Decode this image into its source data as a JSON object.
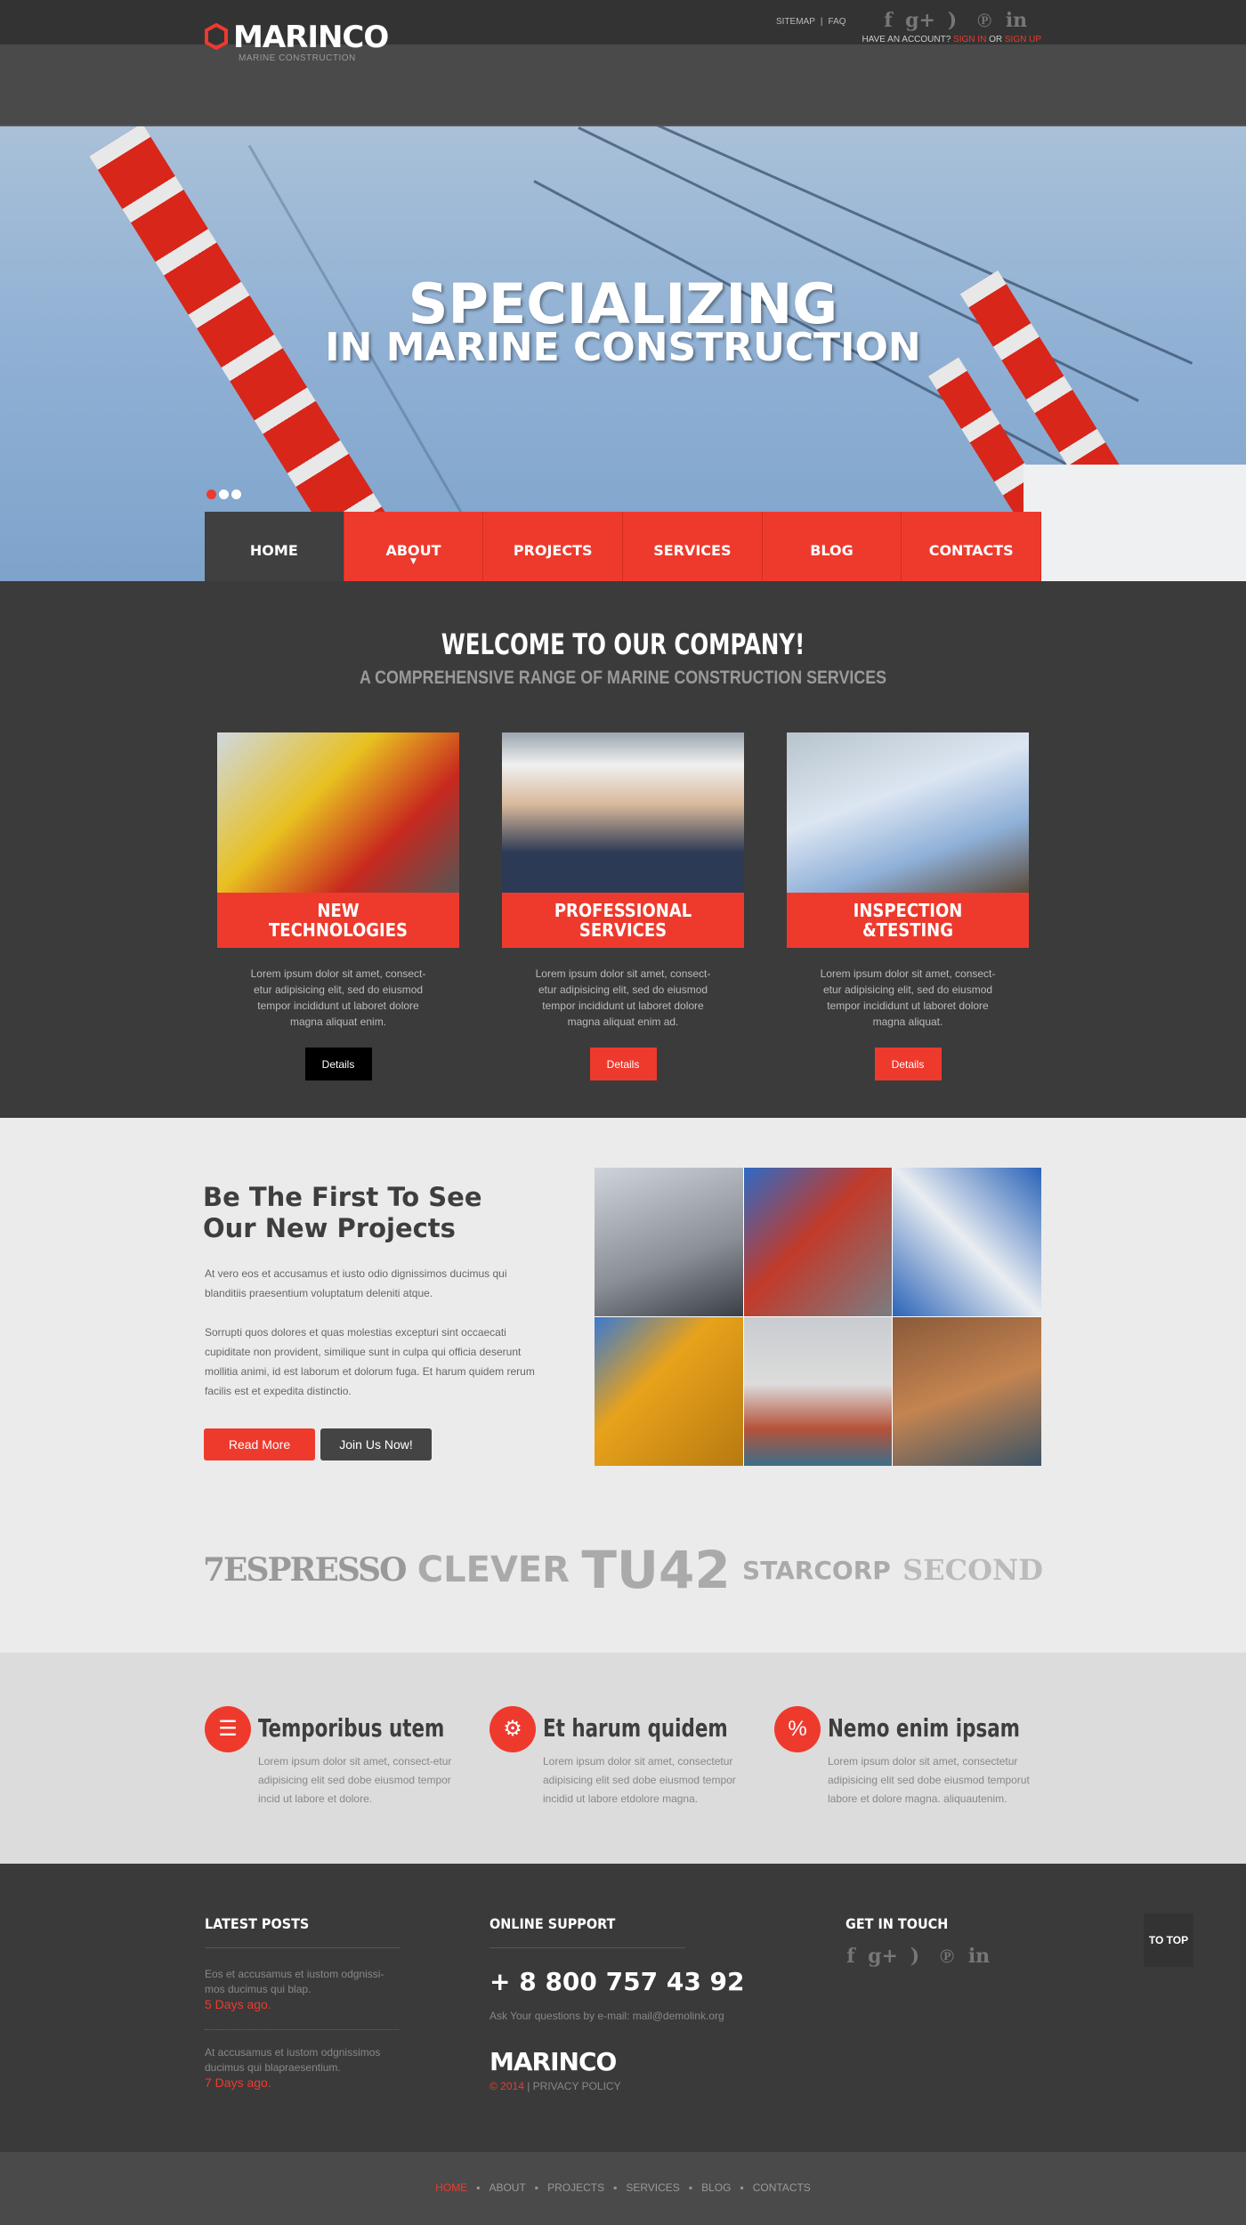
{
  "topbar": {
    "links": [
      "SITEMAP",
      "FAQ"
    ],
    "separator": "|",
    "social": [
      {
        "icon": "facebook-icon",
        "glyph": "f"
      },
      {
        "icon": "google-plus-icon",
        "glyph": "g+"
      },
      {
        "icon": "rss-icon",
        "glyph": ")"
      },
      {
        "icon": "pinterest-icon",
        "glyph": "℗"
      },
      {
        "icon": "linkedin-icon",
        "glyph": "in"
      }
    ]
  },
  "header": {
    "logo": "MARINCO",
    "tagline": "MARINE CONSTRUCTION",
    "account_prompt": "HAVE AN ACCOUNT?",
    "sign_in": "SIGN IN",
    "or": "OR",
    "sign_up": "SIGN UP"
  },
  "hero": {
    "title1": "SPECIALIZING",
    "title2": "IN MARINE CONSTRUCTION",
    "slides": 3,
    "active_slide": 1
  },
  "nav": [
    {
      "label": "HOME",
      "active": true
    },
    {
      "label": "ABOUT",
      "dropdown": true
    },
    {
      "label": "PROJECTS"
    },
    {
      "label": "SERVICES"
    },
    {
      "label": "BLOG"
    },
    {
      "label": "CONTACTS"
    }
  ],
  "welcome": {
    "title": "WELCOME TO OUR COMPANY!",
    "subtitle": "A COMPREHENSIVE RANGE OF MARINE CONSTRUCTION SERVICES",
    "cards": [
      {
        "title": "NEW\nTECHNOLOGIES",
        "text": "Lorem ipsum dolor sit amet, consect-etur adipisicing elit, sed do eiusmod tempor incididunt ut laboret dolore magna aliquat enim.",
        "button": "Details"
      },
      {
        "title": "PROFESSIONAL\nSERVICES",
        "text": "Lorem ipsum dolor sit amet, consect-etur adipisicing elit, sed do eiusmod tempor incididunt ut laboret dolore magna aliquat enim ad.",
        "button": "Details"
      },
      {
        "title": "INSPECTION\n&TESTING",
        "text": "Lorem ipsum dolor sit amet, consect-etur adipisicing elit, sed do eiusmod tempor incididunt ut laboret dolore magna aliquat.",
        "button": "Details"
      }
    ]
  },
  "projects": {
    "title": "Be The First To See Our New Projects",
    "p1": "At vero eos et accusamus et iusto odio dignissimos ducimus qui blanditiis praesentium voluptatum deleniti atque.",
    "p2": "Sorrupti quos dolores et quas molestias excepturi sint occaecati cupiditate non provident, similique sunt in culpa qui officia deserunt mollitia animi, id est laborum et dolorum fuga. Et harum quidem rerum facilis est et expedita distinctio.",
    "read_more": "Read More",
    "join": "Join Us Now!"
  },
  "partners": [
    "7ESPRESSO",
    "CLEVER",
    "TU42",
    "STARCORP",
    "SECOND"
  ],
  "features": [
    {
      "icon": "tablet-touch-icon",
      "title": "Temporibus utem",
      "text": "Lorem ipsum dolor sit amet, consect-etur adipisicing elit sed dobe eiusmod tempor incid ut labore et dolore."
    },
    {
      "icon": "gear-info-icon",
      "title": "Et harum quidem",
      "text": "Lorem ipsum dolor sit amet, consectetur adipisicing elit sed dobe eiusmod tempor incidid ut labore etdolore magna."
    },
    {
      "icon": "calculator-percent-icon",
      "title": "Nemo enim ipsam",
      "text": "Lorem ipsum dolor sit amet, consectetur adipisicing elit sed dobe eiusmod temporut labore et dolore magna. aliquautenim."
    }
  ],
  "footer": {
    "latest_title": "LATEST POSTS",
    "posts": [
      {
        "text": "Eos et accusamus et iustom odgnissi-mos ducimus qui blap.",
        "date": "5 Days ago."
      },
      {
        "text": "At accusamus et iustom odgnissimos ducimus qui blapraesentium.",
        "date": "7 Days ago."
      }
    ],
    "support_title": "ONLINE SUPPORT",
    "phone": "+ 8 800 757 43 92",
    "email_text": "Ask Your questions by e-mail: mail@demolink.org",
    "brand": "MARINCO",
    "copyright": "© 2014",
    "privacy": "| PRIVACY POLICY",
    "touch_title": "GET IN TOUCH",
    "to_top": "TO TOP"
  },
  "bottom_nav": [
    "HOME",
    "ABOUT",
    "PROJECTS",
    "SERVICES",
    "BLOG",
    "CONTACTS"
  ],
  "colors": {
    "accent": "#ee3a2d",
    "dark": "#3b3b3b",
    "header": "#4a4a4a",
    "light": "#ebebeb"
  }
}
